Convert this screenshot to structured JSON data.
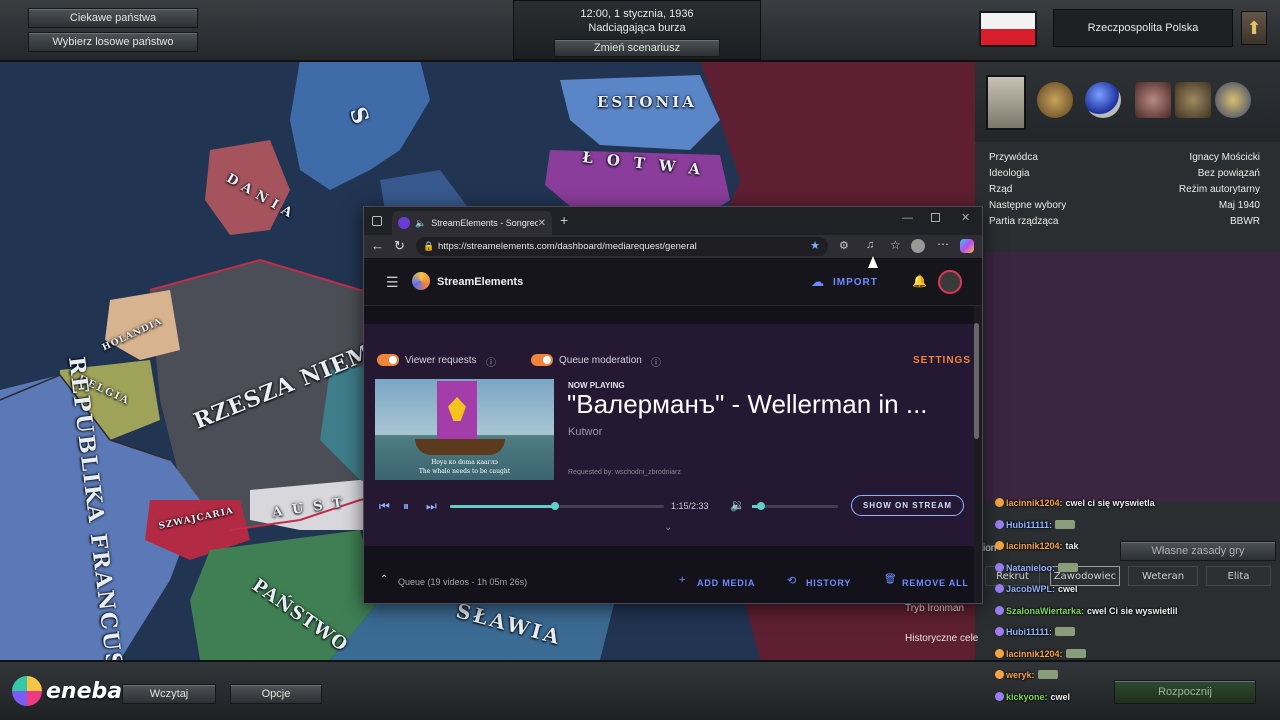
{
  "game": {
    "top_left_buttons": [
      "Ciekawe państwa",
      "Wybierz losowe państwo"
    ],
    "date": "12:00, 1 stycznia, 1936",
    "scenario": "Nadciągająca burza",
    "change_scenario": "Zmień scenariusz",
    "country_name": "Rzeczpospolita Polska",
    "flag_colors": [
      "#f2f2f2",
      "#d81e2b"
    ],
    "info": [
      {
        "label": "Przywódca",
        "value": "Ignacy Mościcki"
      },
      {
        "label": "Ideologia",
        "value": "Bez powiązań"
      },
      {
        "label": "Rząd",
        "value": "Reżim autorytarny"
      },
      {
        "label": "Następne wybory",
        "value": "Maj 1940"
      },
      {
        "label": "Partia rządząca",
        "value": "BBWR"
      }
    ],
    "map_labels": {
      "estonia": "ESTONIA",
      "lotwa": "ŁOTWA",
      "dania": "DANIA",
      "holandia": "HOLANDIA",
      "belgia": "BELGIA",
      "rzesza": "RZESZA NIEMIECKA",
      "francja": "REPUBLIKA FRANCUSKA",
      "szwajcaria": "SZWAJCARIA",
      "austria": "AUST",
      "panstwo": "PAŃSTWO",
      "slawia": "SŁAWIA",
      "s_label": "S"
    },
    "bottom_buttons": [
      "Wczytaj",
      "Opcje"
    ],
    "bottom_menu": {
      "ironman": "Tryb Ironman",
      "historical": "Historyczne cele",
      "custom_rules": "Własne zasady gry",
      "difficulty": [
        "Rekrut",
        "Zawodowiec",
        "Weteran",
        "Elita"
      ],
      "start": "Rozpocznij",
      "partial_left": "ion"
    }
  },
  "chat": [
    {
      "user": "lacinnik1204:",
      "msg": "cwel ci się wyswietla",
      "color": "#f6a343"
    },
    {
      "user": "Hubi11111:",
      "msg": "",
      "color": "#8fb4ff"
    },
    {
      "user": "lacinnik1204:",
      "msg": "tak",
      "color": "#f6a343"
    },
    {
      "user": "Natanieloo:",
      "msg": "",
      "color": "#8fb4ff"
    },
    {
      "user": "JacobWPL:",
      "msg": "cwel",
      "color": "#8fb4ff"
    },
    {
      "user": "SzalonaWiertarka:",
      "msg": "cwel Ci sie wyswietlil",
      "color": "#7ed957"
    },
    {
      "user": "Hubi11111:",
      "msg": "",
      "color": "#8fb4ff"
    },
    {
      "user": "lacinnik1204:",
      "msg": "",
      "color": "#f6a343"
    },
    {
      "user": "weryk:",
      "msg": "",
      "color": "#f6a343"
    },
    {
      "user": "kickyone:",
      "msg": "cwel",
      "color": "#7ed957"
    }
  ],
  "eneba": "eneba",
  "browser": {
    "tab_title": "StreamElements - Songreque",
    "url": "https://streamelements.com/dashboard/mediarequest/general",
    "brand": "StreamElements",
    "import": "IMPORT",
    "viewer_requests": "Viewer requests",
    "queue_moderation": "Queue moderation",
    "settings": "SETTINGS",
    "now_playing_label": "NOW PLAYING",
    "song_title": "\"Валерманъ\" - Wellerman in ...",
    "artist": "Kutwor",
    "requested_by": "Requested by: wschodni_zbrodniarz",
    "time": "1:15/2:33",
    "progress": 0.49,
    "volume": 0.1,
    "show_on_stream": "SHOW ON STREAM",
    "queue": "Queue (19 videos - 1h 05m 26s)",
    "add_media": "ADD MEDIA",
    "history": "HISTORY",
    "remove_all": "REMOVE ALL",
    "thumb_caption_1": "Hoya ко doma кааглэ",
    "thumb_caption_2": "The whale needs to be caught",
    "accent": "#f0843c",
    "link_color": "#6d8bff"
  }
}
